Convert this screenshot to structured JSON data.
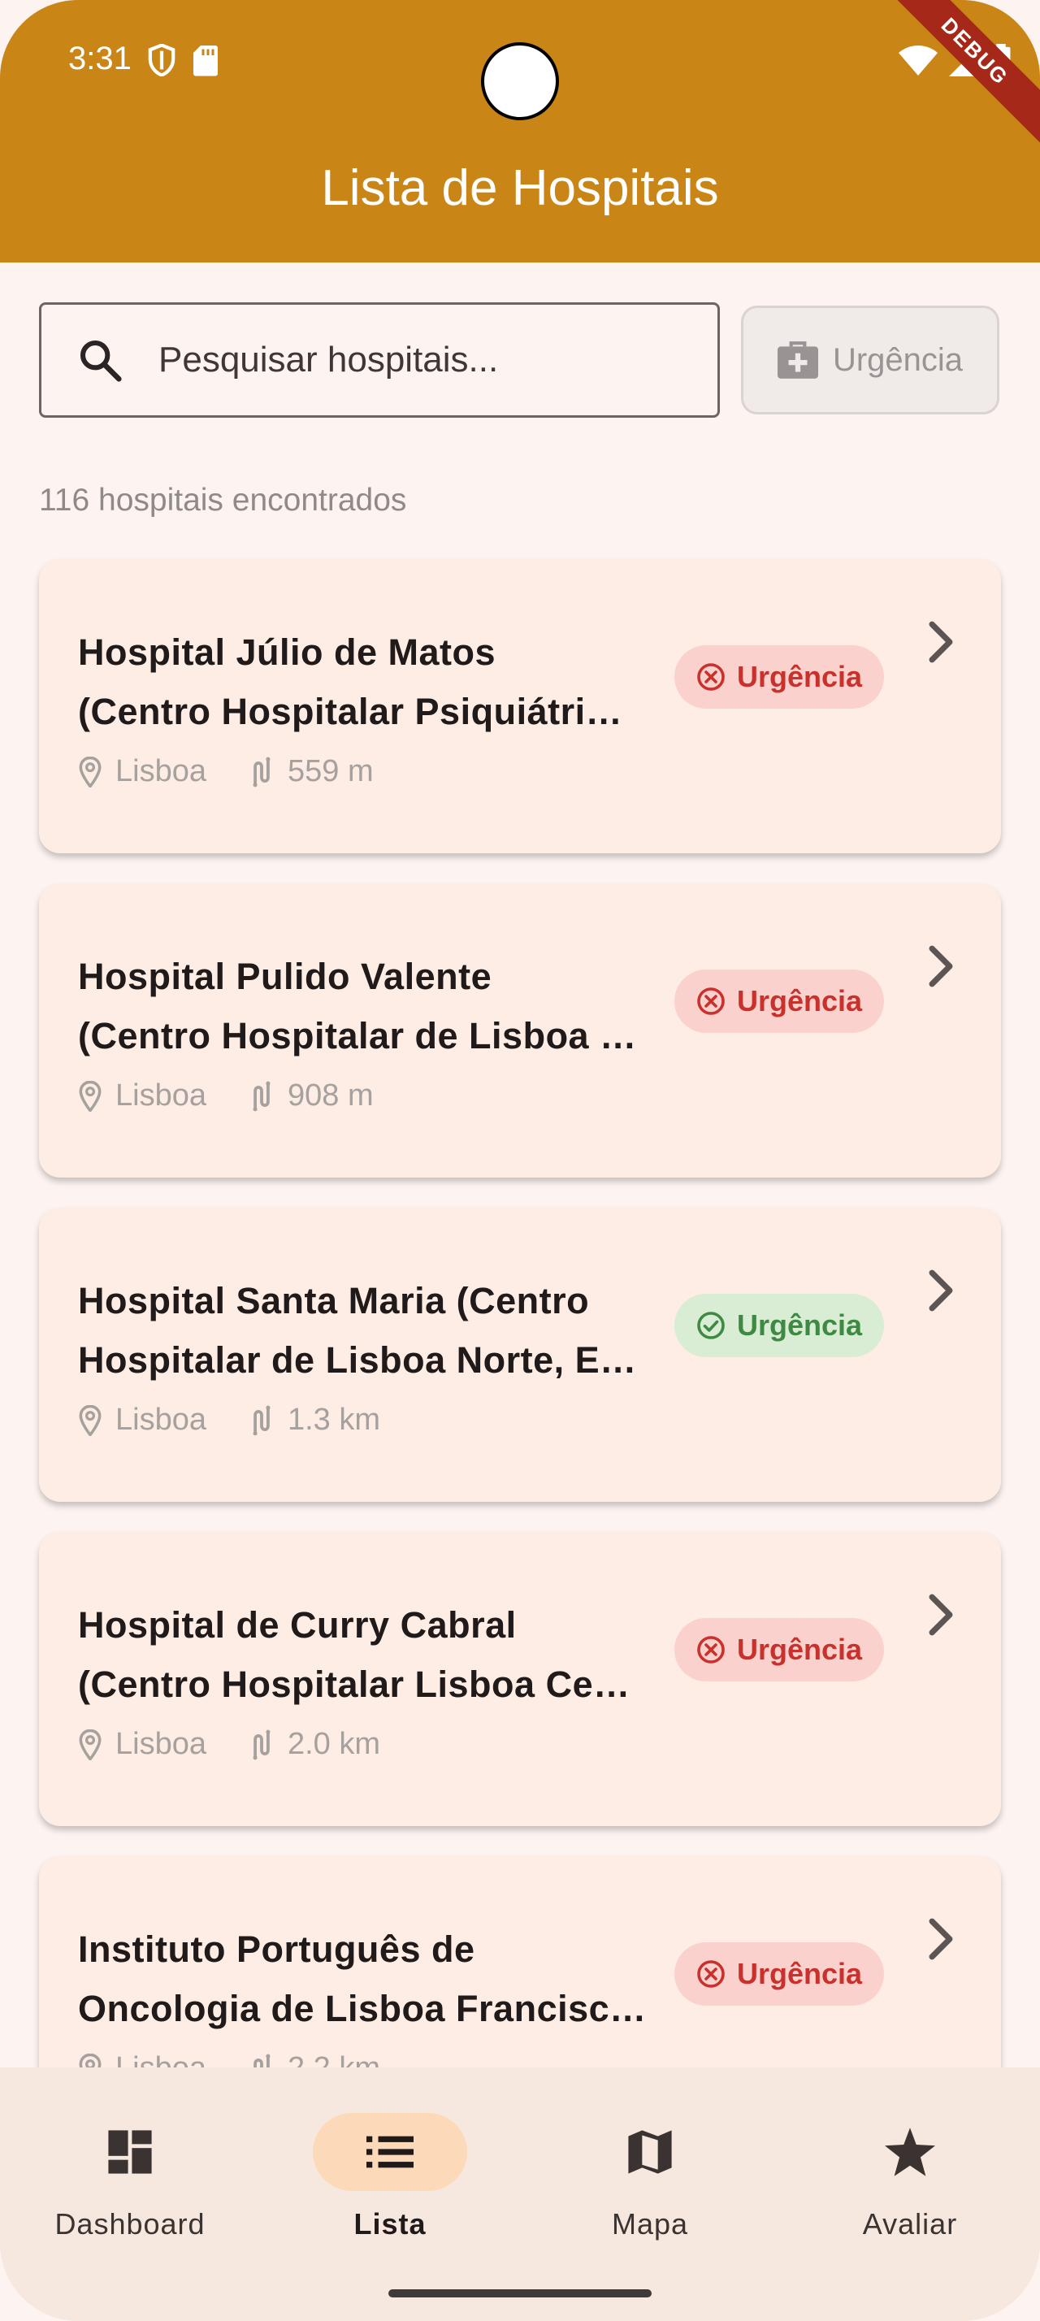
{
  "status_bar": {
    "time": "3:31"
  },
  "debug_label": "DEBUG",
  "app_bar": {
    "title": "Lista de Hospitais"
  },
  "search": {
    "placeholder": "Pesquisar hospitais...",
    "value": ""
  },
  "urgency_filter": {
    "label": "Urgência",
    "icon": "medical-bag-icon"
  },
  "results_count": "116 hospitais encontrados",
  "hospitals": [
    {
      "name_line1": "Hospital Júlio de Matos",
      "name_line2": "(Centro Hospitalar Psiquiátri…",
      "city": "Lisboa",
      "distance": "559 m",
      "badge": "Urgência",
      "urgency_available": false
    },
    {
      "name_line1": "Hospital Pulido Valente",
      "name_line2": "(Centro Hospitalar de Lisboa …",
      "city": "Lisboa",
      "distance": "908 m",
      "badge": "Urgência",
      "urgency_available": false
    },
    {
      "name_line1": "Hospital Santa Maria (Centro",
      "name_line2": "Hospitalar de Lisboa Norte, E…",
      "city": "Lisboa",
      "distance": "1.3 km",
      "badge": "Urgência",
      "urgency_available": true
    },
    {
      "name_line1": "Hospital de Curry Cabral",
      "name_line2": "(Centro Hospitalar Lisboa Ce…",
      "city": "Lisboa",
      "distance": "2.0 km",
      "badge": "Urgência",
      "urgency_available": false
    },
    {
      "name_line1": "Instituto Português de",
      "name_line2": "Oncologia de Lisboa Francisc…",
      "city": "Lisboa",
      "distance": "2.2 km",
      "badge": "Urgência",
      "urgency_available": false
    }
  ],
  "bottom_nav": [
    {
      "label": "Dashboard",
      "icon": "dashboard-icon",
      "active": false
    },
    {
      "label": "Lista",
      "icon": "list-icon",
      "active": true
    },
    {
      "label": "Mapa",
      "icon": "map-icon",
      "active": false
    },
    {
      "label": "Avaliar",
      "icon": "star-icon",
      "active": false
    }
  ],
  "colors": {
    "app_bar": "#ca8517",
    "urgency_closed": "#c9312c",
    "urgency_open": "#3e8a43",
    "background": "#fdf4f1"
  }
}
